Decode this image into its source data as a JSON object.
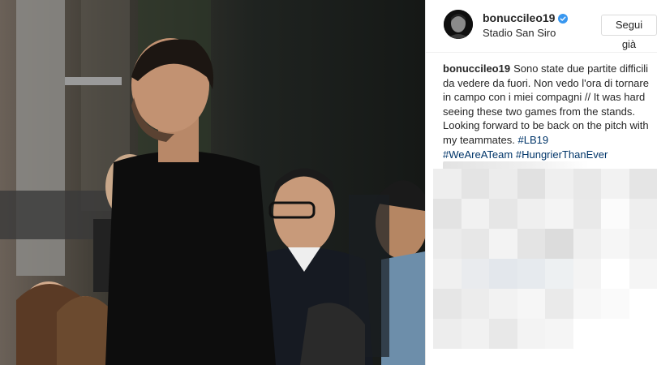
{
  "post": {
    "username": "bonuccileo19",
    "verified": true,
    "location": "Stadio San Siro",
    "follow_label": "Segui già",
    "caption": {
      "username": "bonuccileo19",
      "text": "Sono state due partite difficili da vedere da fuori. Non vedo l'ora di tornare in campo con i miei compagni // It was hard seeing these two games from the stands. Looking forward to be back on the pitch with my teammates.",
      "hashtags": [
        "#LB19",
        "#WeAreATeam",
        "#HungrierThanEver"
      ]
    }
  },
  "colors": {
    "verified_badge": "#3897f0",
    "hashtag": "#003569",
    "text": "#262626"
  },
  "icons": {
    "verified": "verified-badge-icon",
    "avatar": "profile-avatar"
  }
}
